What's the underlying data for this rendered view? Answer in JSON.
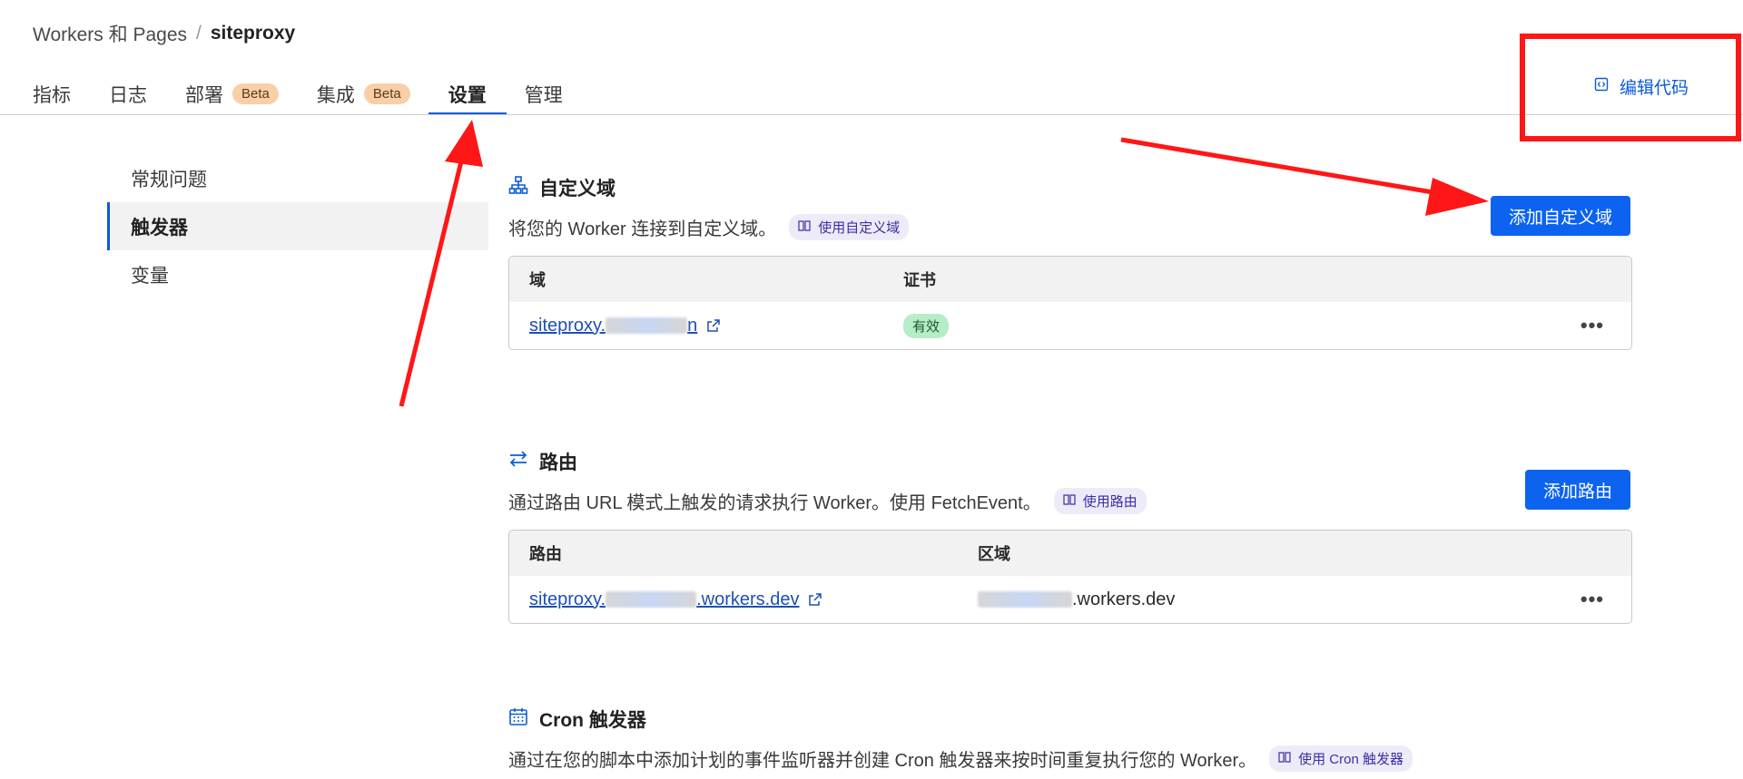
{
  "breadcrumb": {
    "root": "Workers 和 Pages",
    "separator": "/",
    "current": "siteproxy"
  },
  "tabs": [
    {
      "label": "指标",
      "badge": ""
    },
    {
      "label": "日志",
      "badge": ""
    },
    {
      "label": "部署",
      "badge": "Beta"
    },
    {
      "label": "集成",
      "badge": "Beta"
    },
    {
      "label": "设置",
      "badge": "",
      "active": true
    },
    {
      "label": "管理",
      "badge": ""
    }
  ],
  "edit_code": {
    "label": "编辑代码",
    "icon": "code-icon"
  },
  "sidebar": {
    "items": [
      {
        "label": "常规问题"
      },
      {
        "label": "触发器",
        "active": true
      },
      {
        "label": "变量"
      }
    ]
  },
  "custom_domains": {
    "icon": "sitemap-icon",
    "title": "自定义域",
    "description": "将您的 Worker 连接到自定义域。",
    "doc_link": "使用自定义域",
    "add_button": "添加自定义域",
    "columns": [
      "域",
      "证书"
    ],
    "rows": [
      {
        "domain_prefix": "siteproxy.",
        "domain_suffix": "n",
        "certificate": "有效"
      }
    ]
  },
  "routes": {
    "icon": "swap-arrows-icon",
    "title": "路由",
    "description": "通过路由 URL 模式上触发的请求执行 Worker。使用 FetchEvent。",
    "doc_link": "使用路由",
    "add_button": "添加路由",
    "columns": [
      "路由",
      "区域"
    ],
    "rows": [
      {
        "route_prefix": "siteproxy.",
        "route_suffix": ".workers.dev",
        "zone_suffix": ".workers.dev"
      }
    ]
  },
  "cron": {
    "icon": "calendar-icon",
    "title": "Cron 触发器",
    "description": "通过在您的脚本中添加计划的事件监听器并创建 Cron 触发器来按时间重复执行您的 Worker。",
    "doc_link": "使用 Cron 触发器"
  },
  "colors": {
    "accent": "#0b5cd6",
    "button": "#0b63f0",
    "annotation": "#ff1616",
    "beta_badge": "#f9cfa8",
    "valid_badge": "#b7ecc8"
  }
}
